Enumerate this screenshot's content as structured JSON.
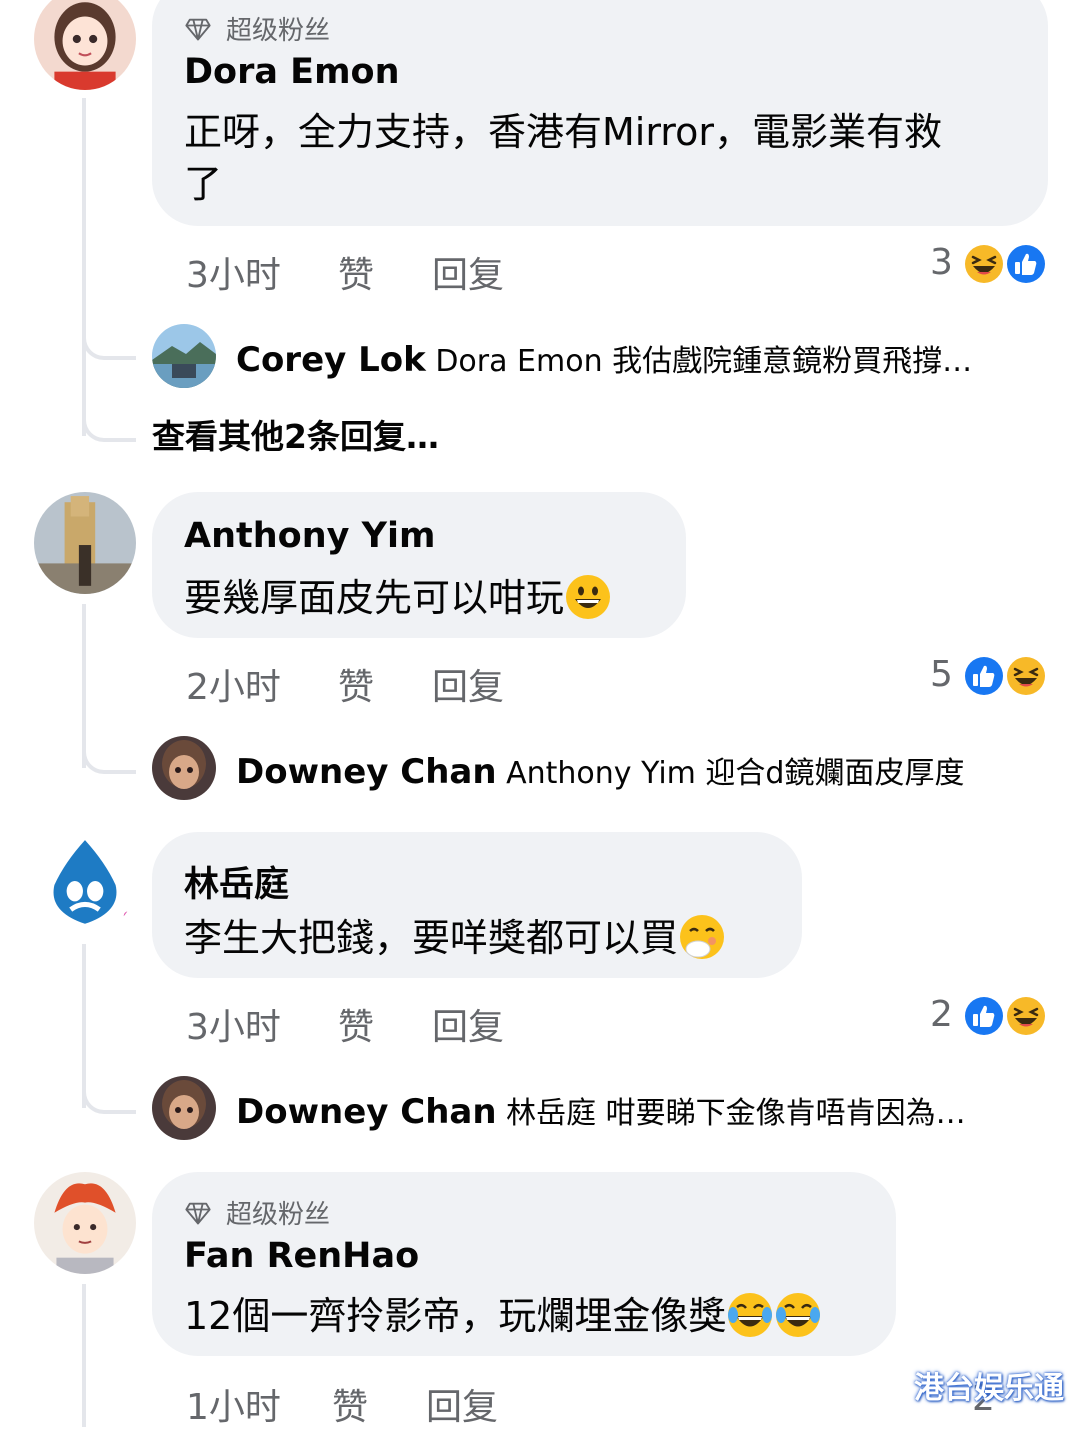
{
  "comments": [
    {
      "badge": "超级粉丝",
      "author": "Dora Emon",
      "text_line1": "正呀，全力支持，香港有Mirror，電影業有救",
      "text_line2": "了",
      "time": "3小时",
      "like": "赞",
      "reply": "回复",
      "reaction_count": "3",
      "reactions": [
        "laugh-icon",
        "like-icon"
      ],
      "replies": [
        {
          "author": "Corey Lok",
          "text": "Dora Emon 我估戲院鍾意鏡粉買飛撐…"
        }
      ],
      "more_replies": "查看其他2条回复…"
    },
    {
      "author": "Anthony Yim",
      "text": "要幾厚面皮先可以咁玩",
      "emoji": "grinning-emoji",
      "time": "2小时",
      "like": "赞",
      "reply": "回复",
      "reaction_count": "5",
      "reactions": [
        "like-icon",
        "laugh-icon"
      ],
      "replies": [
        {
          "author": "Downey Chan",
          "text": "Anthony Yim 迎合d鏡孄面皮厚度"
        }
      ]
    },
    {
      "author": "林岳庭",
      "text": "李生大把錢，要咩獎都可以買",
      "emoji": "hand-over-mouth-emoji",
      "time": "3小时",
      "like": "赞",
      "reply": "回复",
      "reaction_count": "2",
      "reactions": [
        "like-icon",
        "laugh-icon"
      ],
      "replies": [
        {
          "author": "Downey Chan",
          "text": "林岳庭 咁要睇下金像肯唔肯因為…"
        }
      ]
    },
    {
      "badge": "超级粉丝",
      "author": "Fan RenHao",
      "text": "12個一齊拎影帝，玩爛埋金像獎",
      "emoji": "tears-of-joy-emoji",
      "time": "1小时",
      "like": "赞",
      "reply": "回复",
      "reaction_count": "2"
    }
  ],
  "watermark": "港台娱乐通",
  "colors": {
    "like_blue": "#1877f2",
    "laugh_yellow": "#f7b928",
    "bubble_gray": "#f0f2f5",
    "meta_gray": "#65676b"
  }
}
